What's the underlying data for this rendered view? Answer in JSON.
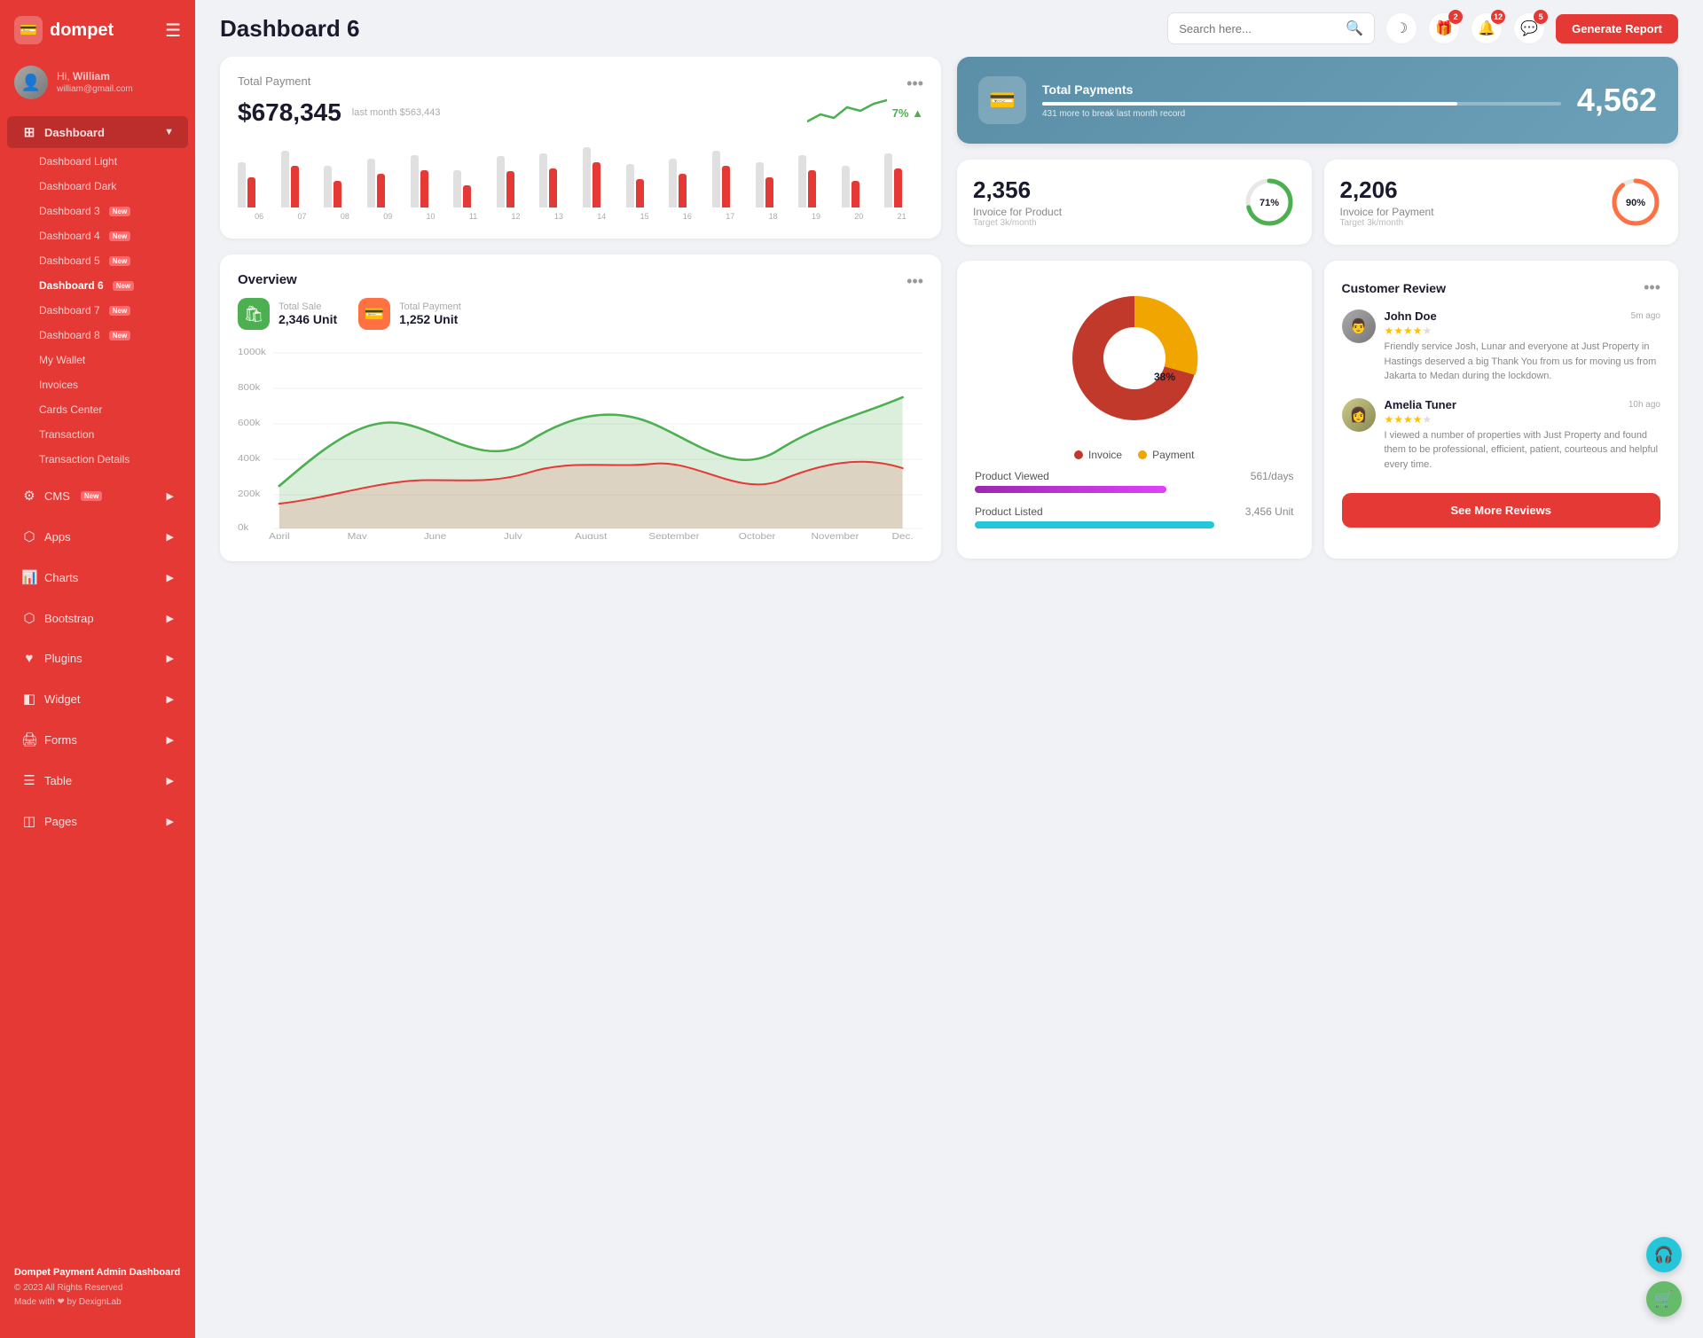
{
  "app": {
    "name": "dompet",
    "logo_icon": "💳"
  },
  "user": {
    "greeting": "Hi, William",
    "name": "William",
    "email": "william@gmail.com",
    "avatar_icon": "👤"
  },
  "sidebar": {
    "menu_items": [
      {
        "id": "dashboard",
        "label": "Dashboard",
        "icon": "⊞",
        "has_arrow": true,
        "active": true
      },
      {
        "id": "cms",
        "label": "CMS",
        "icon": "⚙",
        "has_arrow": true,
        "badge": "New"
      },
      {
        "id": "apps",
        "label": "Apps",
        "icon": "☰",
        "has_arrow": true
      },
      {
        "id": "charts",
        "label": "Charts",
        "icon": "📊",
        "has_arrow": true
      },
      {
        "id": "bootstrap",
        "label": "Bootstrap",
        "icon": "⬡",
        "has_arrow": true
      },
      {
        "id": "plugins",
        "label": "Plugins",
        "icon": "♥",
        "has_arrow": true
      },
      {
        "id": "widget",
        "label": "Widget",
        "icon": "◧",
        "has_arrow": true
      },
      {
        "id": "forms",
        "label": "Forms",
        "icon": "🖨",
        "has_arrow": true
      },
      {
        "id": "table",
        "label": "Table",
        "icon": "☰",
        "has_arrow": true
      },
      {
        "id": "pages",
        "label": "Pages",
        "icon": "◫",
        "has_arrow": true
      }
    ],
    "sub_items": [
      {
        "label": "Dashboard Light"
      },
      {
        "label": "Dashboard Dark"
      },
      {
        "label": "Dashboard 3",
        "badge": "New"
      },
      {
        "label": "Dashboard 4",
        "badge": "New"
      },
      {
        "label": "Dashboard 5",
        "badge": "New"
      },
      {
        "label": "Dashboard 6",
        "badge": "New",
        "active": true
      },
      {
        "label": "Dashboard 7",
        "badge": "New"
      },
      {
        "label": "Dashboard 8",
        "badge": "New"
      },
      {
        "label": "My Wallet"
      },
      {
        "label": "Invoices"
      },
      {
        "label": "Cards Center"
      },
      {
        "label": "Transaction"
      },
      {
        "label": "Transaction Details"
      }
    ],
    "footer": {
      "title": "Dompet Payment Admin Dashboard",
      "copy": "© 2023 All Rights Reserved",
      "made_with": "Made with ❤ by DexignLab"
    }
  },
  "topbar": {
    "title": "Dashboard 6",
    "search_placeholder": "Search here...",
    "icons": [
      {
        "id": "theme",
        "icon": "☽",
        "badge": null
      },
      {
        "id": "gift",
        "icon": "🎁",
        "badge": "2"
      },
      {
        "id": "bell",
        "icon": "🔔",
        "badge": "12"
      },
      {
        "id": "chat",
        "icon": "💬",
        "badge": "5"
      }
    ],
    "generate_btn": "Generate Report"
  },
  "total_payment": {
    "label": "Total Payment",
    "amount": "$678,345",
    "last_month": "last month $563,443",
    "trend": "7%",
    "bar_labels": [
      "06",
      "07",
      "08",
      "09",
      "10",
      "11",
      "12",
      "13",
      "14",
      "15",
      "16",
      "17",
      "18",
      "19",
      "20",
      "21"
    ],
    "bars_gray": [
      60,
      75,
      55,
      65,
      70,
      50,
      68,
      72,
      80,
      58,
      65,
      75,
      60,
      70,
      55,
      72
    ],
    "bars_red": [
      40,
      55,
      35,
      45,
      50,
      30,
      48,
      52,
      60,
      38,
      45,
      55,
      40,
      50,
      35,
      52
    ]
  },
  "blue_card": {
    "icon": "💳",
    "title": "Total Payments",
    "subtitle": "431 more to break last month record",
    "number": "4,562",
    "progress": 80
  },
  "invoice_product": {
    "number": "2,356",
    "label": "Invoice for Product",
    "target": "Target 3k/month",
    "percent": 71,
    "color": "#4caf50"
  },
  "invoice_payment": {
    "number": "2,206",
    "label": "Invoice for Payment",
    "target": "Target 3k/month",
    "percent": 90,
    "color": "#ff7043"
  },
  "overview": {
    "label": "Overview",
    "total_sale_label": "Total Sale",
    "total_sale_value": "2,346 Unit",
    "total_payment_label": "Total Payment",
    "total_payment_value": "1,252 Unit",
    "chart_labels": [
      "April",
      "May",
      "June",
      "July",
      "August",
      "September",
      "October",
      "November",
      "Dec."
    ],
    "chart_y_labels": [
      "1000k",
      "800k",
      "600k",
      "400k",
      "200k",
      "0k"
    ]
  },
  "pie_chart": {
    "invoice_percent": 62,
    "payment_percent": 38,
    "invoice_label": "Invoice",
    "payment_label": "Payment",
    "invoice_color": "#c0392b",
    "payment_color": "#f0a500"
  },
  "product_stats": {
    "viewed_label": "Product Viewed",
    "viewed_value": "561/days",
    "listed_label": "Product Listed",
    "listed_value": "3,456 Unit"
  },
  "reviews": {
    "title": "Customer Review",
    "items": [
      {
        "name": "John Doe",
        "time": "5m ago",
        "stars": 4,
        "text": "Friendly service Josh, Lunar and everyone at Just Property in Hastings deserved a big Thank You from us for moving us from Jakarta to Medan during the lockdown.",
        "avatar": "👨"
      },
      {
        "name": "Amelia Tuner",
        "time": "10h ago",
        "stars": 4,
        "text": "I viewed a number of properties with Just Property and found them to be professional, efficient, patient, courteous and helpful every time.",
        "avatar": "👩"
      }
    ],
    "see_more_btn": "See More Reviews"
  },
  "fabs": [
    {
      "id": "support",
      "icon": "🎧",
      "color": "#26c6da"
    },
    {
      "id": "cart",
      "icon": "🛒",
      "color": "#66bb6a"
    }
  ]
}
